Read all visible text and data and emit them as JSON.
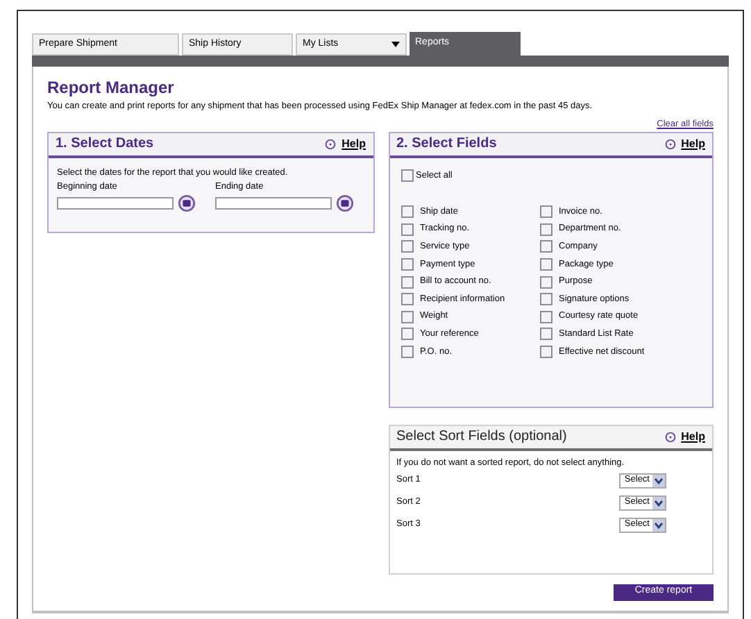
{
  "tabs": [
    {
      "label": "Prepare Shipment",
      "selected": false,
      "dropdown": false
    },
    {
      "label": "Ship History",
      "selected": false,
      "dropdown": false
    },
    {
      "label": "My Lists",
      "selected": false,
      "dropdown": true
    },
    {
      "label": "Reports",
      "selected": true,
      "dropdown": false
    }
  ],
  "title": "Report Manager",
  "intro": "You can create and print reports for any shipment that has been processed using FedEx Ship Manager at fedex.com in the past 45 days.",
  "clear_link": "Clear all fields",
  "dates_panel": {
    "heading": "1. Select Dates",
    "help": "Help",
    "instruction": "Select the dates for the report that you would like created.",
    "fields": [
      {
        "label": "Beginning date"
      },
      {
        "label": "Ending date"
      }
    ]
  },
  "fields_panel": {
    "heading": "2. Select Fields",
    "help": "Help",
    "select_all": {
      "label": "Select all",
      "checked": false
    },
    "columns": [
      [
        {
          "label": "Ship date",
          "checked": false
        },
        {
          "label": "Tracking no.",
          "checked": false
        },
        {
          "label": "Service type",
          "checked": false
        },
        {
          "label": "Payment type",
          "checked": false
        },
        {
          "label": "Bill to account no.",
          "checked": false
        },
        {
          "label": "Recipient information",
          "checked": false
        },
        {
          "label": "Weight",
          "checked": false
        },
        {
          "label": "Your reference",
          "checked": false
        },
        {
          "label": "P.O. no.",
          "checked": false
        }
      ],
      [
        {
          "label": "Invoice no.",
          "checked": false
        },
        {
          "label": "Department no.",
          "checked": false
        },
        {
          "label": "Company",
          "checked": false
        },
        {
          "label": "Package type",
          "checked": false
        },
        {
          "label": "Purpose",
          "checked": false
        },
        {
          "label": "Signature options",
          "checked": false
        },
        {
          "label": "Courtesy rate quote",
          "checked": false
        },
        {
          "label": "Standard List Rate",
          "checked": false
        },
        {
          "label": "Effective net discount",
          "checked": false
        }
      ]
    ]
  },
  "sort_panel": {
    "heading": "Select Sort Fields (optional)",
    "help": "Help",
    "instruction": "If you do not want a sorted report, do not select anything.",
    "sorts": [
      {
        "label": "Sort 1",
        "value": "Select"
      },
      {
        "label": "Sort 2",
        "value": "Select"
      },
      {
        "label": "Sort 3",
        "value": "Select"
      }
    ]
  },
  "create_button": "Create report"
}
